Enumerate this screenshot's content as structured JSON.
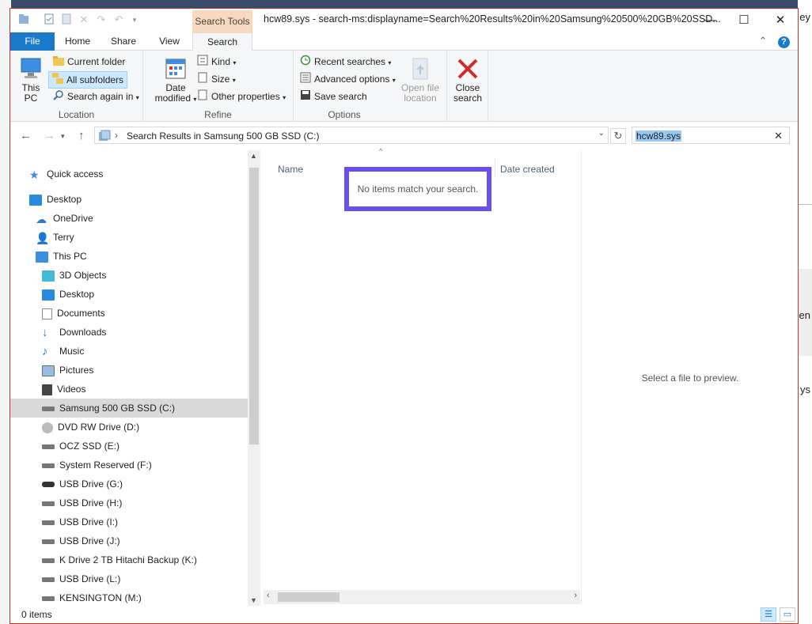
{
  "window": {
    "title": "hcw89.sys - search-ms:displayname=Search%20Results%20in%20Samsung%20500%20GB%20SSD...",
    "context_tab": "Search Tools",
    "minimize": "—",
    "maximize": "☐",
    "close": "✕"
  },
  "tabs": [
    {
      "label": "File"
    },
    {
      "label": "Home"
    },
    {
      "label": "Share"
    },
    {
      "label": "View"
    },
    {
      "label": "Search"
    }
  ],
  "ribbon": {
    "location": {
      "group_label": "Location",
      "this_pc_line1": "This",
      "this_pc_line2": "PC",
      "current_folder": "Current folder",
      "all_subfolders": "All subfolders",
      "search_again_in": "Search again in"
    },
    "refine": {
      "group_label": "Refine",
      "date_modified_line1": "Date",
      "date_modified_line2": "modified",
      "kind": "Kind",
      "size": "Size",
      "other_properties": "Other properties"
    },
    "options": {
      "group_label": "Options",
      "recent_searches": "Recent searches",
      "advanced_options": "Advanced options",
      "save_search": "Save search",
      "open_file_location_line1": "Open file",
      "open_file_location_line2": "location",
      "close_search_line1": "Close",
      "close_search_line2": "search"
    }
  },
  "address": {
    "path": "Search Results in Samsung 500 GB SSD (C:)",
    "search_value": "hcw89.sys"
  },
  "nav": {
    "items": [
      {
        "label": "Quick access"
      },
      {
        "label": "Desktop"
      },
      {
        "label": "OneDrive"
      },
      {
        "label": "Terry"
      },
      {
        "label": "This PC"
      },
      {
        "label": "3D Objects"
      },
      {
        "label": "Desktop"
      },
      {
        "label": "Documents"
      },
      {
        "label": "Downloads"
      },
      {
        "label": "Music"
      },
      {
        "label": "Pictures"
      },
      {
        "label": "Videos"
      },
      {
        "label": "Samsung 500 GB SSD (C:)"
      },
      {
        "label": "DVD RW Drive (D:)"
      },
      {
        "label": "OCZ SSD (E:)"
      },
      {
        "label": "System Reserved (F:)"
      },
      {
        "label": "USB Drive (G:)"
      },
      {
        "label": "USB Drive (H:)"
      },
      {
        "label": "USB Drive (I:)"
      },
      {
        "label": "USB Drive (J:)"
      },
      {
        "label": "K Drive 2 TB Hitachi Backup (K:)"
      },
      {
        "label": "USB Drive (L:)"
      },
      {
        "label": "KENSINGTON (M:)"
      }
    ]
  },
  "content": {
    "col_name": "Name",
    "col_date_created": "Date created",
    "empty_message": "No items match your search.",
    "preview_message": "Select a file to preview."
  },
  "status": {
    "count": "0 items"
  },
  "desktop_right": {
    "text1": "ey",
    "text2": "en",
    "text3": "ys"
  }
}
